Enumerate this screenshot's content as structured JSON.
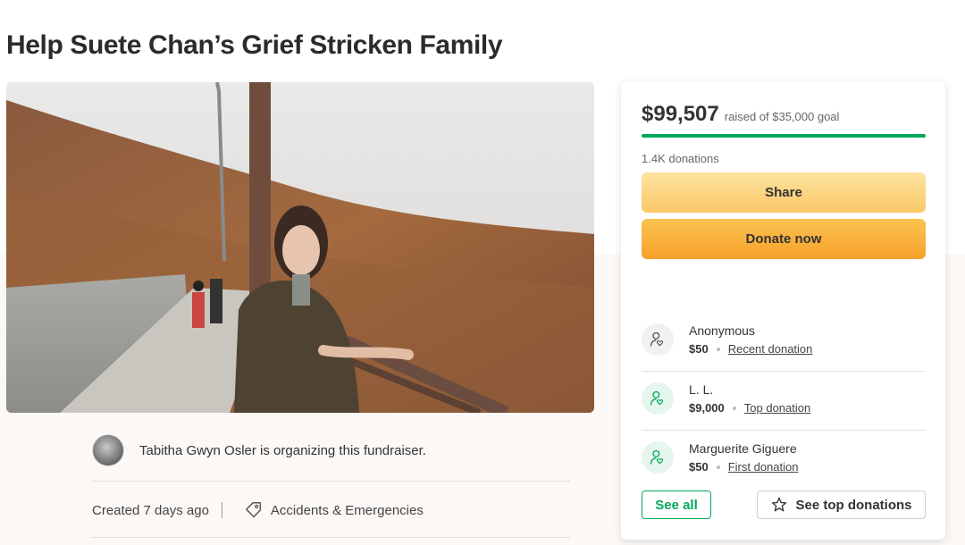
{
  "page": {
    "title": "Help Suete Chan’s Grief Stricken Family"
  },
  "organizer": {
    "text": "Tabitha Gwyn Osler is organizing this fundraiser."
  },
  "meta": {
    "created": "Created 7 days ago",
    "category": "Accidents & Emergencies"
  },
  "donation_card": {
    "amount_raised": "$99,507",
    "goal_text": "raised of $35,000 goal",
    "progress_fraction": 1.0,
    "donations_count": "1.4K donations",
    "share_label": "Share",
    "donate_label": "Donate now",
    "donations": [
      {
        "name": "Anonymous",
        "amount": "$50",
        "type": "Recent donation",
        "icon": "donor-icon"
      },
      {
        "name": "L. L.",
        "amount": "$9,000",
        "type": "Top donation",
        "icon": "donor-icon"
      },
      {
        "name": "Marguerite Giguere",
        "amount": "$50",
        "type": "First donation",
        "icon": "donor-icon"
      }
    ],
    "see_all_label": "See all",
    "see_top_label": "See top donations"
  },
  "colors": {
    "accent_green": "#02a95c",
    "share_yellow": "#fbc866",
    "donate_orange": "#f7a12c"
  }
}
